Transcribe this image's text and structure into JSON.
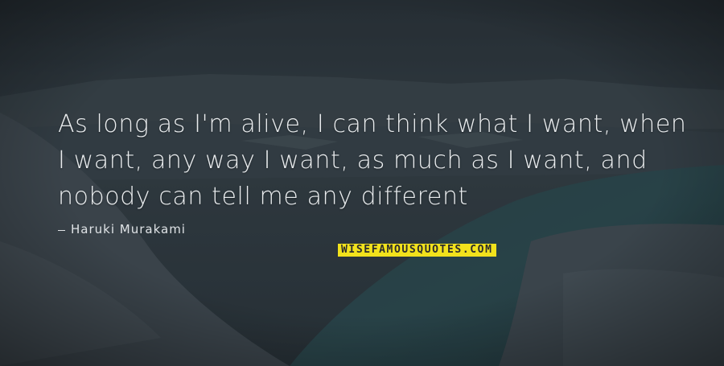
{
  "quote": {
    "text": "As long as I'm alive, I can think what I want, when I want, any way I want, as much as I want, and nobody can tell me any different"
  },
  "author": {
    "name": "Haruki Murakami"
  },
  "brand": {
    "label": "WISEFAMOUSQUOTES.COM",
    "background": "#f2e21c"
  },
  "colors": {
    "text": "#e9ecee",
    "background": "#2f3a41"
  }
}
